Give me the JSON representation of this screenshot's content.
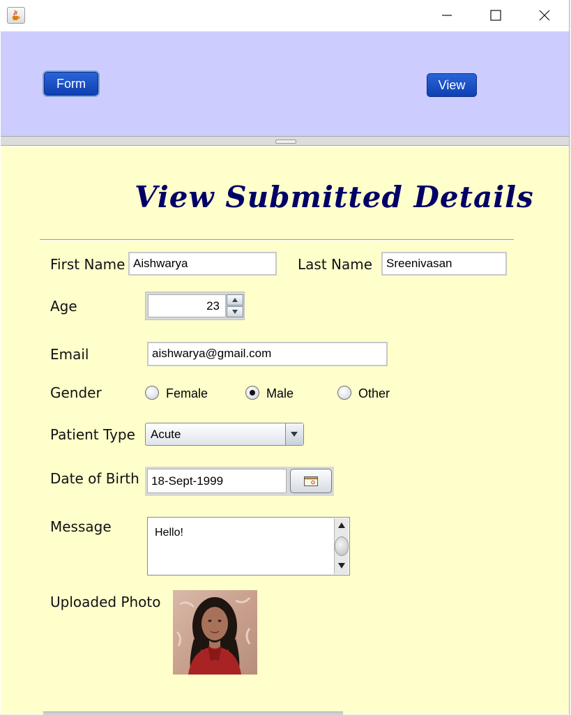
{
  "window": {
    "icon": "java-cup-icon",
    "controls": [
      "minimize-icon",
      "maximize-icon",
      "close-icon"
    ]
  },
  "nav": {
    "form_label": "Form",
    "view_label": "View"
  },
  "content": {
    "heading": "View Submitted Details",
    "first_name": {
      "label": "First Name",
      "value": "Aishwarya"
    },
    "last_name": {
      "label": "Last Name",
      "value": "Sreenivasan"
    },
    "age": {
      "label": "Age",
      "value": "23"
    },
    "email": {
      "label": "Email",
      "value": "aishwarya@gmail.com"
    },
    "gender": {
      "label": "Gender",
      "options": [
        "Female",
        "Male",
        "Other"
      ],
      "selected": "Male"
    },
    "patient_type": {
      "label": "Patient Type",
      "value": "Acute"
    },
    "dob": {
      "label": "Date of Birth",
      "value": "18-Sept-1999"
    },
    "message": {
      "label": "Message",
      "value": "Hello!"
    },
    "photo": {
      "label": "Uploaded Photo"
    }
  },
  "colors": {
    "top_panel": "#ccccff",
    "bottom_panel": "#ffffcc",
    "heading": "#000066",
    "button": "#1a4fc4"
  }
}
